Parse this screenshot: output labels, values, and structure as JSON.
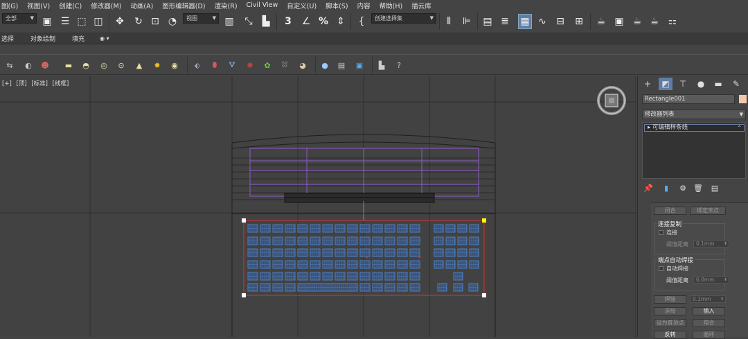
{
  "menu": [
    "图(G)",
    "视图(V)",
    "创建(C)",
    "修改器(M)",
    "动画(A)",
    "图形编辑器(D)",
    "渲染(R)",
    "Civil View",
    "自定义(U)",
    "脚本(S)",
    "内容",
    "帮助(H)",
    "插云库"
  ],
  "toolbar": {
    "selection_filter": "全部",
    "ref_coord": "视图",
    "named_selection": "创建选择集"
  },
  "ribbon": [
    "选择",
    "对象绘制",
    "填充"
  ],
  "viewport": {
    "labels": [
      "[+]",
      "[顶]",
      "[标准]",
      "[线框]"
    ]
  },
  "panel": {
    "object_name": "Rectangle001",
    "modifier_list": "修改器列表",
    "stack_item": "可编辑样条线",
    "rollout": {
      "top_buttons": [
        "闭合",
        "绑定末点"
      ],
      "connect_copy": {
        "title": "连接复制",
        "checkbox": "连接",
        "threshold_label": "阈值距离",
        "threshold_value": "0.1mm"
      },
      "end_auto_weld": {
        "title": "端点自动焊接",
        "checkbox": "自动焊接",
        "threshold_label": "阈值距离",
        "threshold_value": "6.0mm"
      },
      "weld": {
        "label": "焊接",
        "value": "0.1mm"
      },
      "buttons": [
        [
          "连接",
          "插入"
        ],
        [
          "设为首顶点",
          "熔合"
        ],
        [
          "反转",
          "循环"
        ]
      ]
    }
  },
  "colors": {
    "bg": "#444444",
    "viewport": "#424242",
    "selection": "#c0363a",
    "purple": "#8c5cc8",
    "keys": "#4d7ec0"
  }
}
